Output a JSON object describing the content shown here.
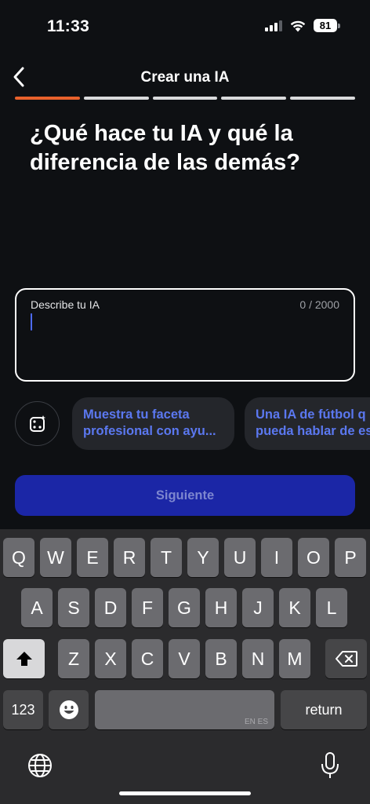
{
  "status_bar": {
    "time": "11:33",
    "battery": "81"
  },
  "header": {
    "title": "Crear una IA",
    "back_icon": "chevron-left-icon"
  },
  "progress": {
    "steps": 5,
    "current": 1,
    "accent": "#e8612c"
  },
  "question": {
    "title": "¿Qué hace tu IA y qué la diferencia de las demás?"
  },
  "field": {
    "label": "Describe tu IA",
    "counter": "0 / 2000",
    "value": ""
  },
  "suggestions": [
    {
      "line1": "Muestra tu faceta",
      "line2": "profesional con ayu..."
    },
    {
      "line1": "Una IA de fútbol q",
      "line2": "pueda hablar de es"
    }
  ],
  "next_button": {
    "label": "Siguiente"
  },
  "keyboard": {
    "row1": [
      "Q",
      "W",
      "E",
      "R",
      "T",
      "Y",
      "U",
      "I",
      "O",
      "P"
    ],
    "row2": [
      "A",
      "S",
      "D",
      "F",
      "G",
      "H",
      "J",
      "K",
      "L"
    ],
    "row3": [
      "Z",
      "X",
      "C",
      "V",
      "B",
      "N",
      "M"
    ],
    "numbers_label": "123",
    "return_label": "return",
    "space_lang": "EN ES"
  }
}
